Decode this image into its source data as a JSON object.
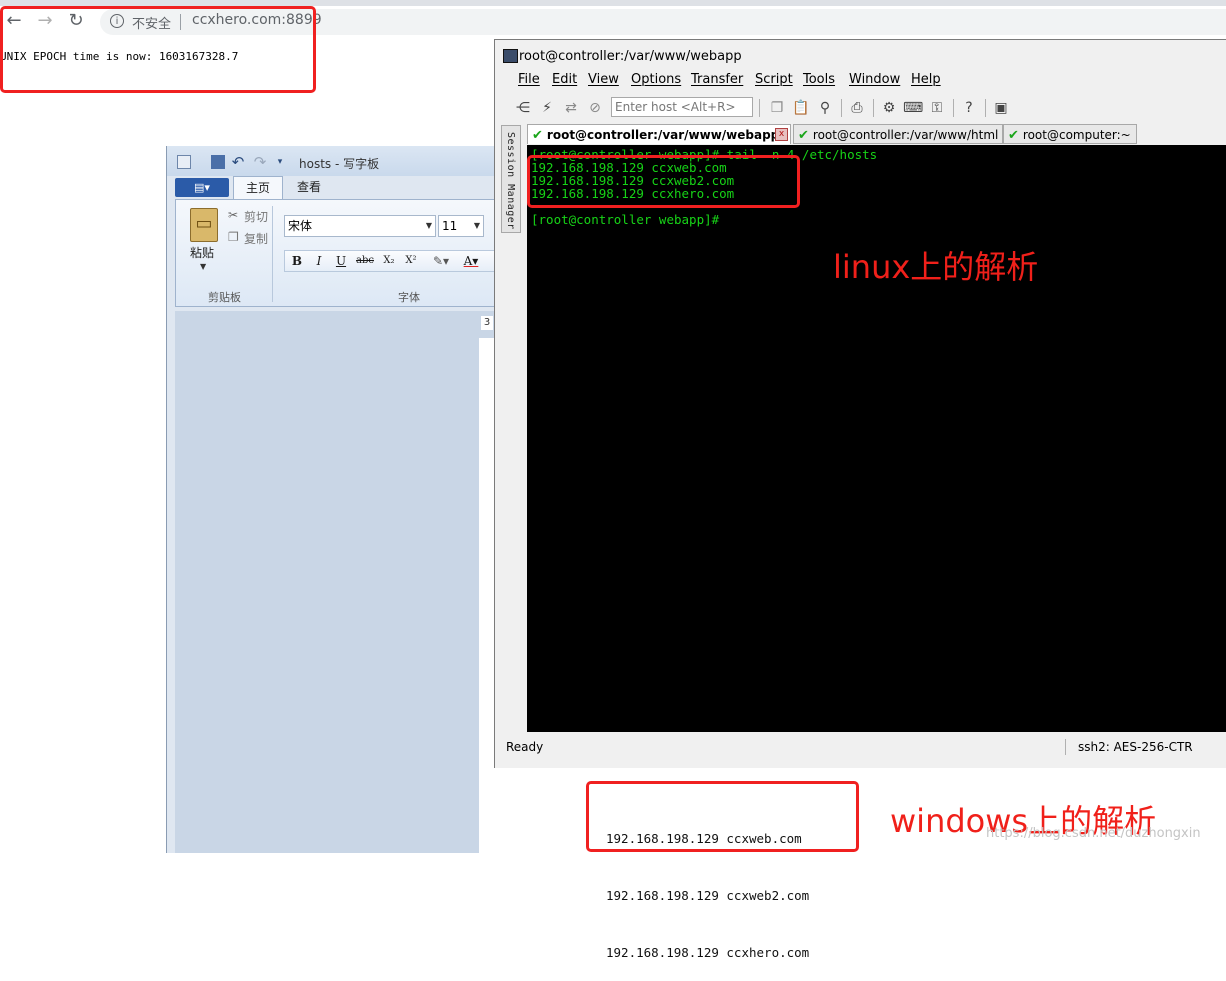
{
  "browser": {
    "back_icon": "←",
    "forward_icon": "→",
    "reload_icon": "↻",
    "info_icon": "i",
    "security_label": "不安全",
    "url": "ccxhero.com:8899",
    "page_text": "UNIX EPOCH time is now: 1603167328.7"
  },
  "wordpad": {
    "title": "hosts - 写字板",
    "menu_button_icon": "▤▾",
    "tabs": [
      "主页",
      "查看"
    ],
    "paste_label": "粘贴",
    "cut_label": "剪切",
    "copy_label": "复制",
    "clipboard_group": "剪贴板",
    "font_group": "字体",
    "font_name": "宋体",
    "font_size": "11",
    "format_buttons": [
      "B",
      "I",
      "U",
      "abc",
      "X₂",
      "X²"
    ],
    "ruler_number": "3"
  },
  "securecrt": {
    "title": "root@controller:/var/www/webapp",
    "menu": [
      "File",
      "Edit",
      "View",
      "Options",
      "Transfer",
      "Script",
      "Tools",
      "Window",
      "Help"
    ],
    "host_placeholder": "Enter host <Alt+R>",
    "session_manager_label": "Session Manager",
    "tabs": [
      "root@controller:/var/www/webapp",
      "root@controller:/var/www/html",
      "root@computer:~"
    ],
    "tab_close_icon": "x",
    "terminal_lines": [
      "[root@controller webapp]# tail -n 4 /etc/hosts",
      "192.168.198.129 ccxweb.com",
      "192.168.198.129 ccxweb2.com",
      "192.168.198.129 ccxhero.com",
      "",
      "[root@controller webapp]#"
    ],
    "status_ready": "Ready",
    "status_cipher": "ssh2: AES-256-CTR"
  },
  "annotations": {
    "linux": "linux上的解析",
    "windows": "windows上的解析"
  },
  "windows_hosts": [
    "192.168.198.129 ccxweb.com",
    "192.168.198.129 ccxweb2.com",
    "192.168.198.129 ccxhero.com"
  ],
  "watermark": "https://blog.csdn.net/duzhongxin",
  "colors": {
    "terminal_bg": "#000000",
    "terminal_text": "#17d317",
    "annotation": "#f0201a"
  }
}
